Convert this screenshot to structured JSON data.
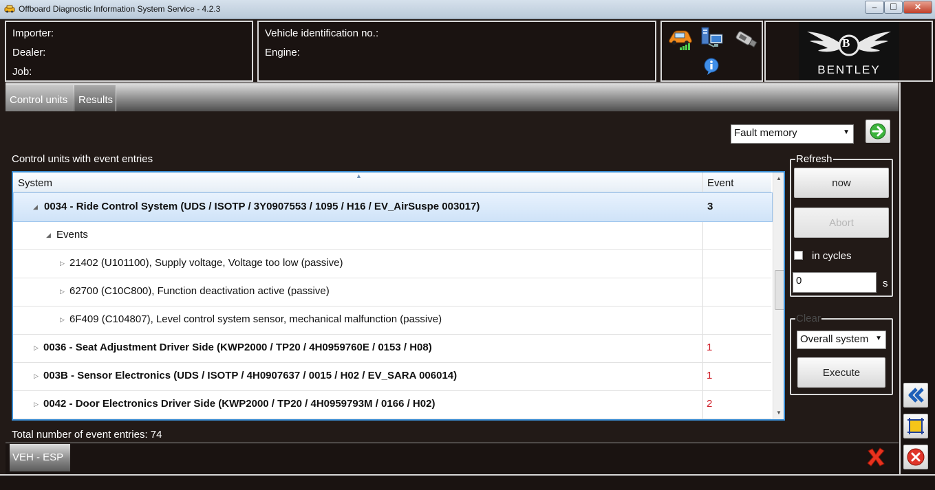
{
  "window": {
    "title": "Offboard Diagnostic Information System Service - 4.2.3",
    "controls": [
      "minimize",
      "maximize",
      "close"
    ]
  },
  "header": {
    "importer_label": "Importer:",
    "dealer_label": "Dealer:",
    "job_label": "Job:",
    "vin_label": "Vehicle identification no.:",
    "engine_label": "Engine:",
    "brand": "BENTLEY",
    "brand_initial": "B"
  },
  "tabs": [
    {
      "label": "Control units",
      "active": false
    },
    {
      "label": "Results",
      "active": true
    }
  ],
  "view_select": "Fault memory",
  "list": {
    "title": "Control units with event entries",
    "columns": [
      "System",
      "Event"
    ],
    "rows": [
      {
        "text": "0034 - Ride Control System  (UDS / ISOTP / 3Y0907553 / 1095 / H16 / EV_AirSuspe 003017)",
        "event": "3",
        "level": 0,
        "selected": true
      },
      {
        "text": "Events",
        "event": "",
        "level": 1
      },
      {
        "text": "21402 (U101100), Supply voltage, Voltage too low  (passive)",
        "event": "",
        "level": 2
      },
      {
        "text": "62700 (C10C800), Function deactivation active  (passive)",
        "event": "",
        "level": 2
      },
      {
        "text": "6F409 (C104807), Level control system sensor, mechanical malfunction  (passive)",
        "event": "",
        "level": 2
      },
      {
        "text": "0036 - Seat Adjustment Driver Side  (KWP2000 / TP20 / 4H0959760E / 0153 / H08)",
        "event": "1",
        "level": 0
      },
      {
        "text": "003B - Sensor Electronics  (UDS / ISOTP / 4H0907637 / 0015 / H02 / EV_SARA 006014)",
        "event": "1",
        "level": 0
      },
      {
        "text": "0042 - Door Electronics Driver Side  (KWP2000 / TP20 / 4H0959793M / 0166 / H02)",
        "event": "2",
        "level": 0
      }
    ],
    "total_label": "Total number of event entries:",
    "total_value": "74"
  },
  "refresh": {
    "title": "Refresh",
    "now_label": "now",
    "abort_label": "Abort",
    "cycles_label": "in cycles",
    "cycles_checked": false,
    "interval_value": "0",
    "unit": "s"
  },
  "clear": {
    "title": "Clear",
    "scope": "Overall system",
    "execute_label": "Execute"
  },
  "footer": {
    "tab_label": "VEH - ESP"
  },
  "colors": {
    "background": "#221a17",
    "selection_border": "#3b8fd6",
    "event_red": "#d0202a"
  }
}
